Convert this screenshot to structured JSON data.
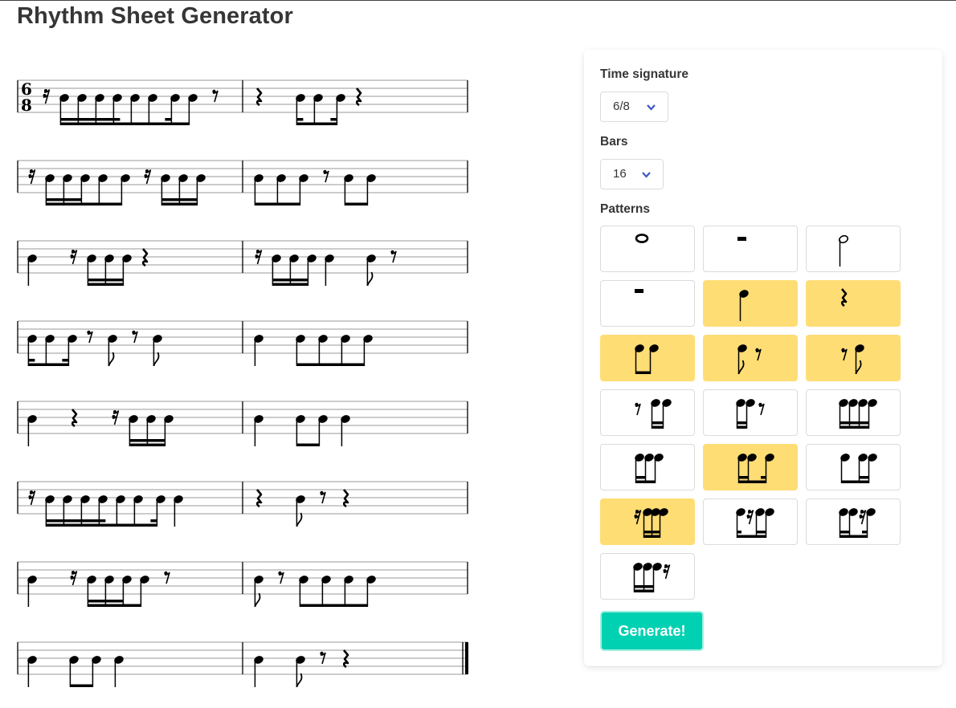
{
  "page": {
    "title": "Rhythm Sheet Generator"
  },
  "sheet": {
    "time_signature": {
      "top": "6",
      "bottom": "8"
    },
    "systems": [
      [
        [
          "rest16",
          "n16",
          "n16",
          "n16",
          "n16d",
          "n16",
          "n8d",
          "n16",
          "n8",
          "rest8"
        ],
        [
          "restq",
          "n16d",
          "n8",
          "n16",
          "restq"
        ]
      ],
      [
        [
          "rest16",
          "n16",
          "n16",
          "n16",
          "n8",
          "n8",
          "rest16",
          "n16",
          "n16",
          "n16"
        ],
        [
          "n8",
          "n8",
          "n8",
          "rest8",
          "n8",
          "n8"
        ]
      ],
      [
        [
          "q",
          "rest16",
          "n16",
          "n16",
          "n16",
          "restq"
        ],
        [
          "rest16",
          "n16",
          "n16",
          "n16",
          "q",
          "n8",
          "rest8"
        ]
      ],
      [
        [
          "n16d",
          "n8",
          "n16",
          "rest8",
          "n8",
          "rest8",
          "n8"
        ],
        [
          "q",
          "n8",
          "n8",
          "n8",
          "n8"
        ]
      ],
      [
        [
          "q",
          "restq",
          "rest16",
          "n16",
          "n16",
          "n16"
        ],
        [
          "q",
          "n8",
          "n8",
          "q"
        ]
      ],
      [
        [
          "rest16",
          "n16",
          "n16",
          "n16",
          "n16d",
          "n16",
          "n8d",
          "n16",
          "q"
        ],
        [
          "restq",
          "n8",
          "rest8",
          "restq"
        ]
      ],
      [
        [
          "q",
          "rest16",
          "n16",
          "n16",
          "n16",
          "n8",
          "rest8"
        ],
        [
          "n8",
          "rest8",
          "n8",
          "n8",
          "n8",
          "n8"
        ]
      ],
      [
        [
          "q",
          "n8",
          "n8",
          "q"
        ],
        [
          "q",
          "n8",
          "rest8",
          "restq"
        ]
      ]
    ]
  },
  "settings": {
    "time_signature": {
      "label": "Time signature",
      "value": "6/8"
    },
    "bars": {
      "label": "Bars",
      "value": "16"
    },
    "patterns_label": "Patterns",
    "patterns": [
      {
        "id": "whole",
        "selected": false
      },
      {
        "id": "whole-rest",
        "selected": false
      },
      {
        "id": "half",
        "selected": false
      },
      {
        "id": "half-rest",
        "selected": false
      },
      {
        "id": "quarter",
        "selected": true
      },
      {
        "id": "quarter-rest",
        "selected": true
      },
      {
        "id": "two-eighths",
        "selected": true
      },
      {
        "id": "eighth-eighth-rest",
        "selected": true
      },
      {
        "id": "eighth-rest-eighth",
        "selected": true
      },
      {
        "id": "eighth-rest-two-sixteenths",
        "selected": false
      },
      {
        "id": "two-sixteenths-eighth-rest",
        "selected": false
      },
      {
        "id": "four-sixteenths",
        "selected": false
      },
      {
        "id": "two-sixteenths-eighth",
        "selected": false
      },
      {
        "id": "dotted-eighth-sixteenth",
        "selected": true
      },
      {
        "id": "eighth-two-sixteenths",
        "selected": false
      },
      {
        "id": "sixteenth-rest-three-sixteenths",
        "selected": true
      },
      {
        "id": "sixteenth-sixteenth-rest-two-sixteenths",
        "selected": false
      },
      {
        "id": "two-sixteenths-rest-sixteenth",
        "selected": false
      },
      {
        "id": "three-sixteenths-sixteenth-rest",
        "selected": false
      }
    ],
    "generate_label": "Generate!"
  },
  "colors": {
    "accent": "#00d1b2",
    "selected": "#ffdd75",
    "chevron": "#3e56c4",
    "text": "#363636"
  }
}
